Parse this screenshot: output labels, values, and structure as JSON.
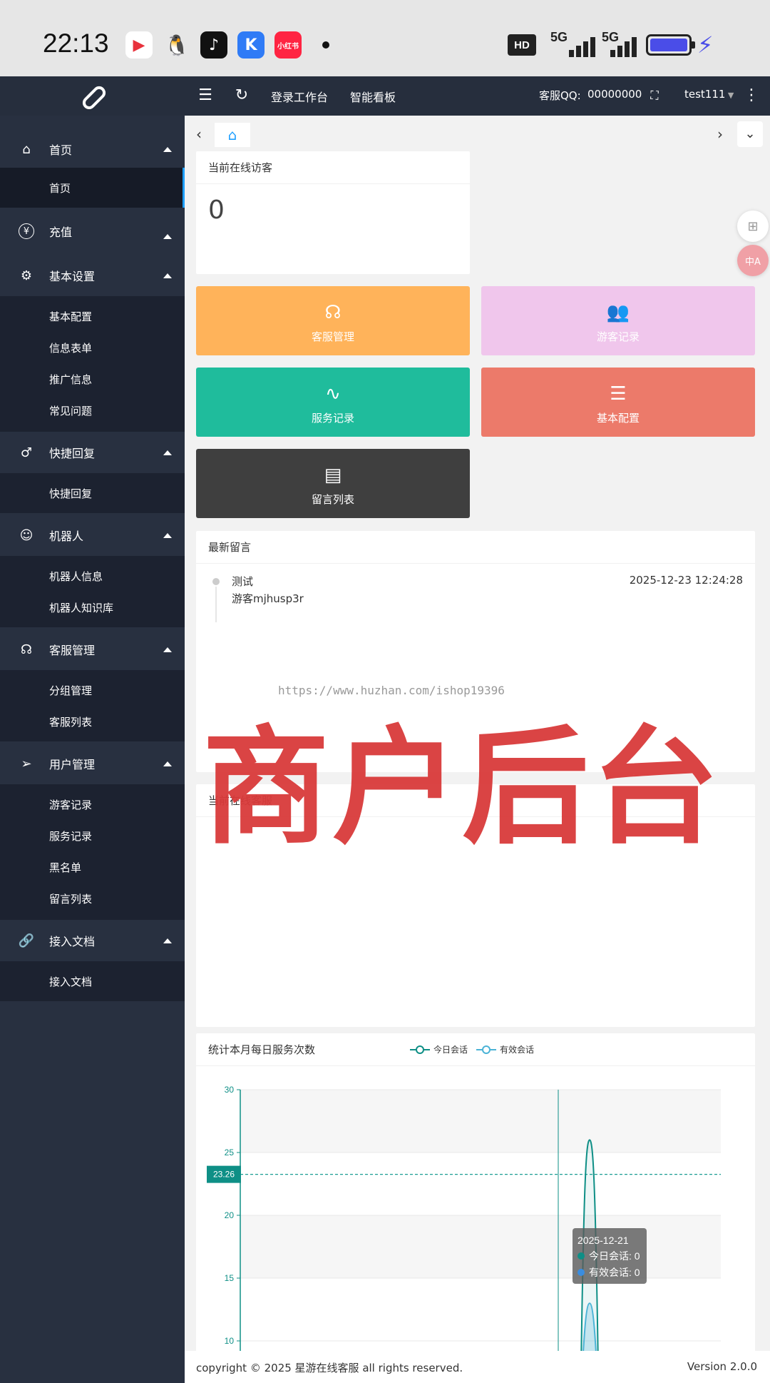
{
  "status_bar": {
    "time": "22:13",
    "apps": [
      {
        "name": "kuaishou",
        "label": "▶",
        "color": "#e8323c"
      },
      {
        "name": "qq",
        "label": "🐧",
        "color": "#12b7f5"
      },
      {
        "name": "tiktok",
        "label": "♪",
        "color": "#111111"
      },
      {
        "name": "k-app",
        "label": "K",
        "color": "#2f7bf6"
      },
      {
        "name": "xiaohongshu",
        "label": "小红书",
        "color": "#ff2442"
      }
    ],
    "hd_label": "HD",
    "signal_1": "5G",
    "signal_2": "5G"
  },
  "topnav": {
    "links": [
      "登录工作台",
      "智能看板"
    ],
    "service_qq_label": "客服QQ:",
    "service_qq_value": "00000000",
    "username": "test111"
  },
  "sidebar": {
    "groups": [
      {
        "label": "首页",
        "icon": "home-icon",
        "items": [
          "首页"
        ]
      },
      {
        "label": "充值",
        "icon": "yen-icon",
        "items": []
      },
      {
        "label": "基本设置",
        "icon": "gear-icon",
        "items": [
          "基本配置",
          "信息表单",
          "推广信息",
          "常见问题"
        ]
      },
      {
        "label": "快捷回复",
        "icon": "male-icon",
        "items": [
          "快捷回复"
        ]
      },
      {
        "label": "机器人",
        "icon": "robot-icon",
        "items": [
          "机器人信息",
          "机器人知识库"
        ]
      },
      {
        "label": "客服管理",
        "icon": "headset-icon",
        "items": [
          "分组管理",
          "客服列表"
        ]
      },
      {
        "label": "用户管理",
        "icon": "send-icon",
        "items": [
          "游客记录",
          "服务记录",
          "黑名单",
          "留言列表"
        ]
      },
      {
        "label": "接入文档",
        "icon": "link-icon",
        "items": [
          "接入文档"
        ]
      }
    ]
  },
  "online_visitors": {
    "title": "当前在线访客",
    "count": "0"
  },
  "tiles": [
    {
      "label": "客服管理",
      "icon": "headset-icon",
      "color": "#ffb35a"
    },
    {
      "label": "游客记录",
      "icon": "users-icon",
      "color": "#f0c6ec"
    },
    {
      "label": "服务记录",
      "icon": "pulse-icon",
      "color": "#1fbc9c"
    },
    {
      "label": "基本配置",
      "icon": "sliders-icon",
      "color": "#ec7a6a"
    },
    {
      "label": "留言列表",
      "icon": "document-icon",
      "color": "#3f3f3f"
    }
  ],
  "latest_messages": {
    "title": "最新留言",
    "items": [
      {
        "title": "测试",
        "visitor": "游客mjhusp3r",
        "time": "2025-12-23 12:24:28"
      }
    ]
  },
  "online_agents": {
    "title": "当前在线客服"
  },
  "watermark": {
    "url": "https://www.huzhan.com/ishop19396",
    "text": "商户后台"
  },
  "chart_data": {
    "type": "line",
    "title": "统计本月每日服务次数",
    "series": [
      {
        "name": "今日会话",
        "color": "#0e8f86"
      },
      {
        "name": "有效会话",
        "color": "#4bb3d6"
      }
    ],
    "y_ticks": [
      30,
      25,
      20,
      15,
      10
    ],
    "ylim_visible": [
      10,
      30
    ],
    "mark_line": 23.26,
    "peak_today": 26,
    "peak_valid": 13,
    "tooltip": {
      "date": "2025-12-21",
      "line1": "今日会话: 0",
      "line2": "有效会话: 0"
    }
  },
  "footer": {
    "copyright": "copyright © 2025 星游在线客服 all rights reserved.",
    "version": "Version 2.0.0"
  }
}
